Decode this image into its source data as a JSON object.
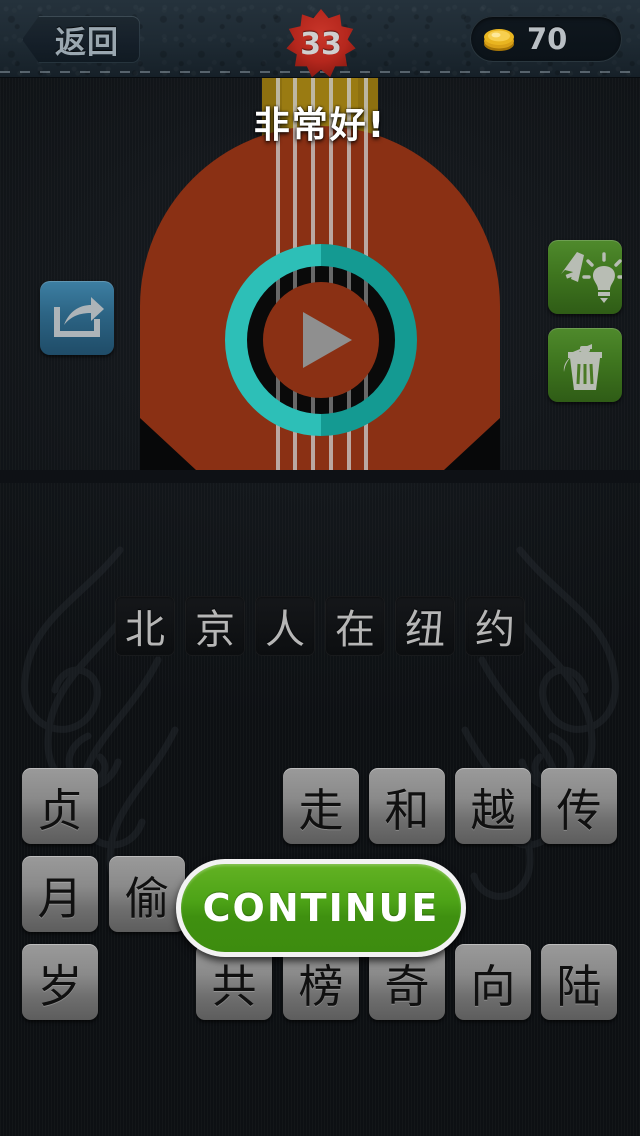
{
  "topbar": {
    "back_label": "返回",
    "back_icon": "back-arrow-icon",
    "level": "33",
    "level_badge_color": "#b5271d",
    "coin_icon": "gold-coin-stack-icon",
    "coin_count": "70",
    "coin_color": "#e8b014"
  },
  "feedback": {
    "title": "非常好!"
  },
  "puzzle_image": {
    "subject": "acoustic-guitar-illustration",
    "body_color": "#8a3014",
    "neck_color": "#9a7b12",
    "soundhole_color": "#0a0a0a",
    "play_overlay": {
      "icon": "play-icon",
      "ring_light": "#2dbfb7",
      "ring_dark": "#149a92",
      "triangle_color": "#8f8f8f"
    }
  },
  "side_buttons": [
    {
      "name": "share-button",
      "icon": "share-arrow-icon",
      "color": "#2c6484"
    },
    {
      "name": "hint-letter-button",
      "icon": "letter-lightbulb-icon",
      "color": "#3f761f"
    },
    {
      "name": "hint-remove-button",
      "icon": "trash-can-icon",
      "color": "#3f761f"
    }
  ],
  "answer": {
    "slots": [
      "北",
      "京",
      "人",
      "在",
      "纽",
      "约"
    ]
  },
  "letter_bank": {
    "rows": [
      [
        {
          "char": "贞",
          "visible": true
        },
        {
          "char": "",
          "visible": false
        },
        {
          "char": "",
          "visible": false
        },
        {
          "char": "走",
          "visible": true
        },
        {
          "char": "和",
          "visible": true
        },
        {
          "char": "越",
          "visible": true
        },
        {
          "char": "传",
          "visible": true
        }
      ],
      [
        {
          "char": "月",
          "visible": true
        },
        {
          "char": "偷",
          "visible": true
        },
        {
          "char": "",
          "visible": false
        },
        {
          "char": "",
          "visible": false
        },
        {
          "char": "",
          "visible": false
        },
        {
          "char": "",
          "visible": false
        },
        {
          "char": "",
          "visible": false
        }
      ],
      [
        {
          "char": "岁",
          "visible": true
        },
        {
          "char": "",
          "visible": false
        },
        {
          "char": "共",
          "visible": true
        },
        {
          "char": "榜",
          "visible": true
        },
        {
          "char": "奇",
          "visible": true
        },
        {
          "char": "向",
          "visible": true
        },
        {
          "char": "陆",
          "visible": true
        }
      ]
    ]
  },
  "continue": {
    "label": "CONTINUE",
    "color": "#4da317"
  }
}
